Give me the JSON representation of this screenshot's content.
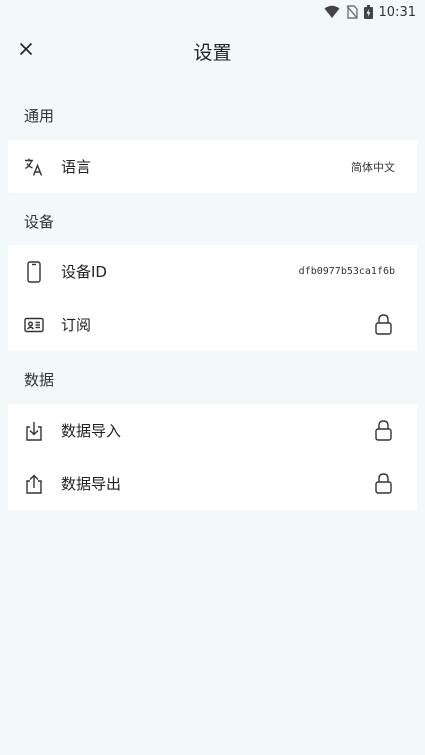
{
  "status_bar": {
    "time": "10:31"
  },
  "header": {
    "title": "设置"
  },
  "sections": {
    "general": {
      "title": "通用",
      "language": {
        "label": "语言",
        "value": "简体中文",
        "icon": "translate-icon"
      }
    },
    "device": {
      "title": "设备",
      "device_id": {
        "label": "设备ID",
        "value": "dfb0977b53ca1f6b",
        "icon": "phone-icon"
      },
      "subscription": {
        "label": "订阅",
        "icon": "id-card-icon",
        "locked": true
      }
    },
    "data": {
      "title": "数据",
      "import": {
        "label": "数据导入",
        "icon": "download-icon",
        "locked": true
      },
      "export": {
        "label": "数据导出",
        "icon": "share-icon",
        "locked": true
      }
    }
  },
  "colors": {
    "background": "#f3f9fa",
    "card": "#ffffff",
    "text": "#222222"
  }
}
